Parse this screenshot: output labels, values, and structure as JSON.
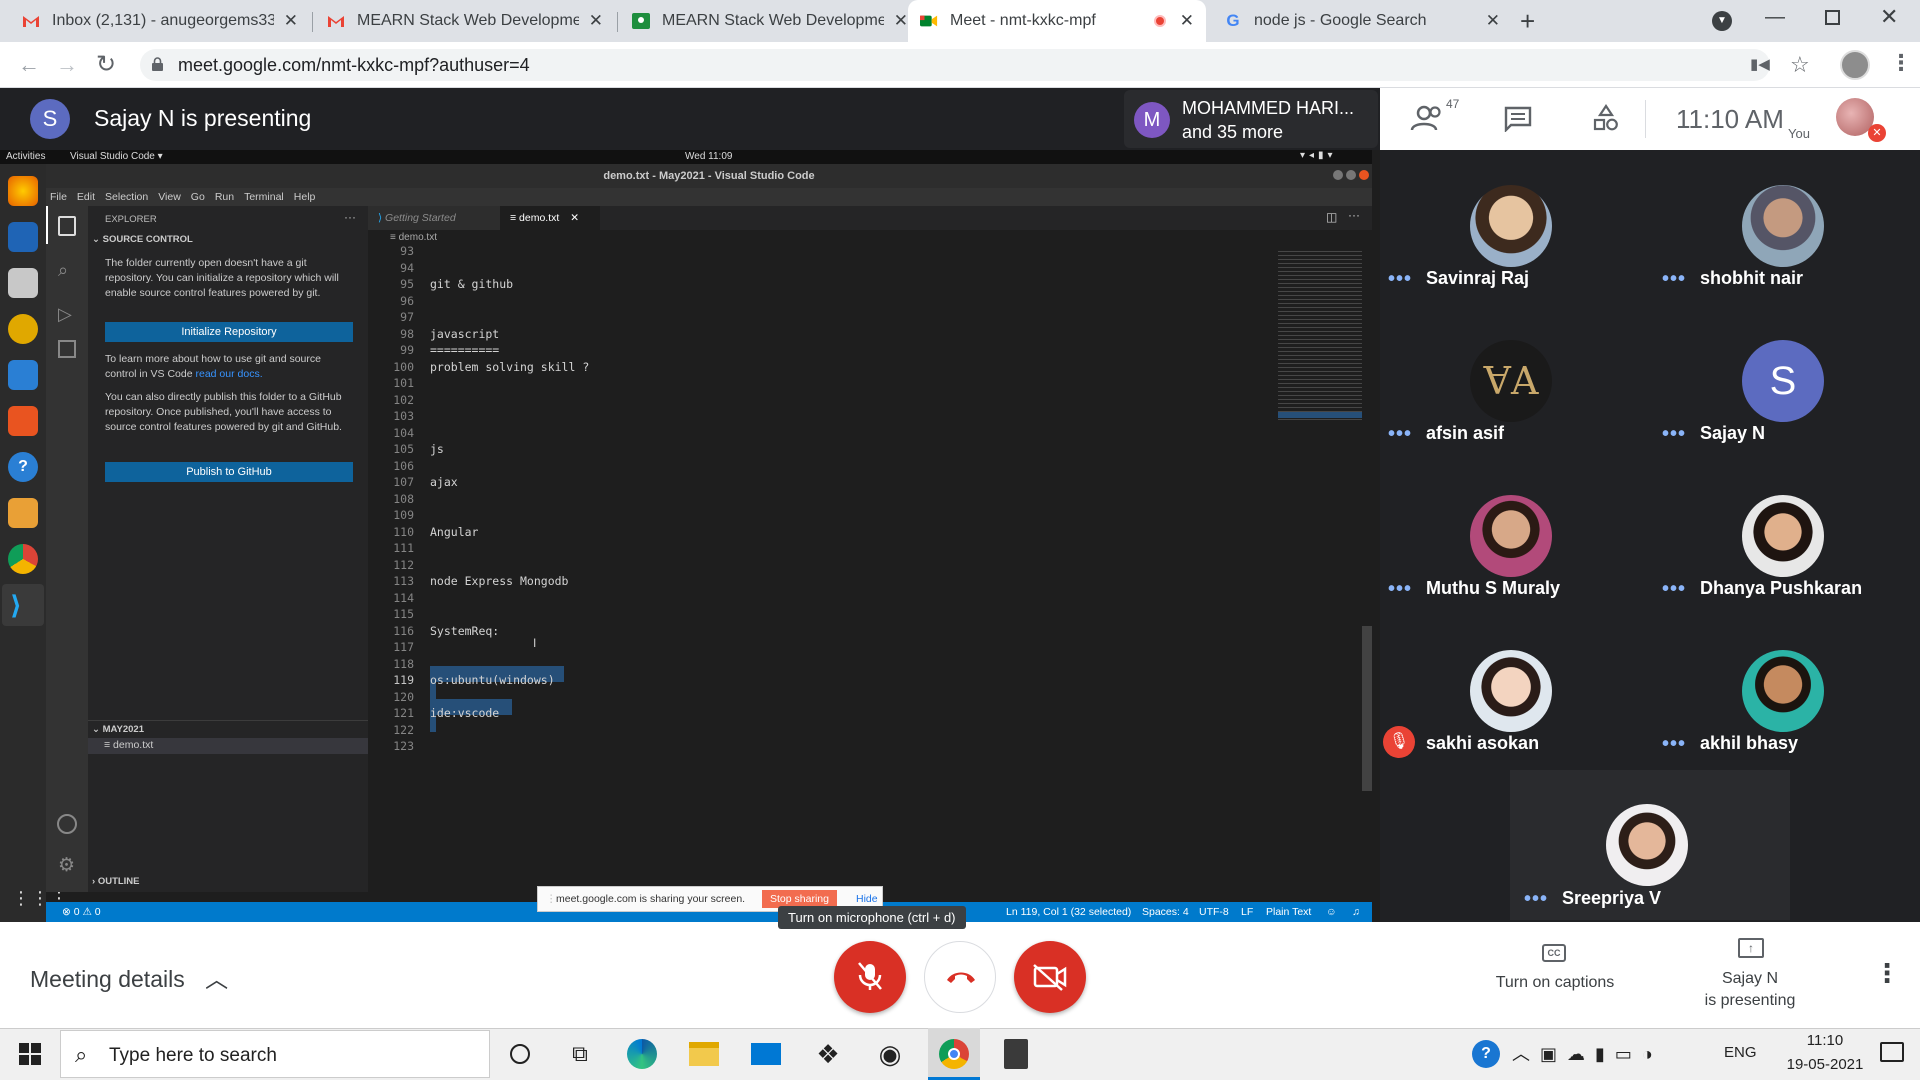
{
  "browser": {
    "tabs": [
      {
        "title": "Inbox (2,131) - anugeorgems333"
      },
      {
        "title": "MEARN Stack Web Development"
      },
      {
        "title": "MEARN Stack Web Development"
      },
      {
        "title": "Meet - nmt-kxkc-mpf"
      },
      {
        "title": "node js - Google Search"
      }
    ],
    "url": "meet.google.com/nmt-kxkc-mpf?authuser=4"
  },
  "meet": {
    "presenter_initial": "S",
    "presenting_title": "Sajay N is presenting",
    "pinned_initial": "M",
    "pinned_name": "MOHAMMED HARI...",
    "pinned_more": "and 35 more",
    "participant_count": "47",
    "time": "11:10 AM",
    "you_label": "You",
    "participants": [
      {
        "name": "Savinraj Raj"
      },
      {
        "name": "shobhit nair"
      },
      {
        "name": "afsin asif"
      },
      {
        "name": "Sajay N",
        "initial": "S"
      },
      {
        "name": "Muthu S Muraly"
      },
      {
        "name": "Dhanya Pushkaran"
      },
      {
        "name": "sakhi asokan"
      },
      {
        "name": "akhil bhasy"
      },
      {
        "name": "Sreepriya V"
      }
    ],
    "meeting_details": "Meeting details",
    "mic_tooltip": "Turn on microphone (ctrl + d)",
    "captions_label": "Turn on captions",
    "presenting_label_1": "Sajay N",
    "presenting_label_2": "is presenting",
    "share_notice": "meet.google.com is sharing your screen.",
    "stop_sharing": "Stop sharing",
    "hide": "Hide"
  },
  "ubuntu": {
    "activities": "Activities",
    "app_name": "Visual Studio Code ▾",
    "clock": "Wed 11:09"
  },
  "vscode": {
    "window_title": "demo.txt - May2021 - Visual Studio Code",
    "menu": [
      "File",
      "Edit",
      "Selection",
      "View",
      "Go",
      "Run",
      "Terminal",
      "Help"
    ],
    "explorer_title": "EXPLORER",
    "section": "SOURCE CONTROL",
    "msg1": "The folder currently open doesn't have a git repository. You can initialize a repository which will enable source control features powered by git.",
    "init_button": "Initialize Repository",
    "msg2": "To learn more about how to use git and source control in VS Code",
    "docs_link": "read our docs.",
    "msg3": "You can also directly publish this folder to a GitHub repository. Once published, you'll have access to source control features powered by git and GitHub.",
    "publish_button": "Publish to GitHub",
    "folder": "MAY2021",
    "file": "demo.txt",
    "outline": "OUTLINE",
    "tab_getting_started": "Getting Started",
    "tab_demo": "demo.txt",
    "breadcrumb": "demo.txt",
    "lines": [
      {
        "n": "93",
        "t": ""
      },
      {
        "n": "94",
        "t": ""
      },
      {
        "n": "95",
        "t": "git & github"
      },
      {
        "n": "96",
        "t": ""
      },
      {
        "n": "97",
        "t": ""
      },
      {
        "n": "98",
        "t": "javascript"
      },
      {
        "n": "99",
        "t": "=========="
      },
      {
        "n": "100",
        "t": "problem solving skill ?"
      },
      {
        "n": "101",
        "t": ""
      },
      {
        "n": "102",
        "t": ""
      },
      {
        "n": "103",
        "t": ""
      },
      {
        "n": "104",
        "t": ""
      },
      {
        "n": "105",
        "t": "js"
      },
      {
        "n": "106",
        "t": ""
      },
      {
        "n": "107",
        "t": "ajax"
      },
      {
        "n": "108",
        "t": ""
      },
      {
        "n": "109",
        "t": ""
      },
      {
        "n": "110",
        "t": "Angular"
      },
      {
        "n": "111",
        "t": ""
      },
      {
        "n": "112",
        "t": ""
      },
      {
        "n": "113",
        "t": "node Express Mongodb"
      },
      {
        "n": "114",
        "t": ""
      },
      {
        "n": "115",
        "t": ""
      },
      {
        "n": "116",
        "t": "SystemReq:"
      },
      {
        "n": "117",
        "t": ""
      },
      {
        "n": "118",
        "t": ""
      },
      {
        "n": "119",
        "t": "os:ubuntu(windows)"
      },
      {
        "n": "120",
        "t": ""
      },
      {
        "n": "121",
        "t": "ide:vscode"
      },
      {
        "n": "122",
        "t": ""
      },
      {
        "n": "123",
        "t": ""
      }
    ],
    "status_left": "⊗ 0 ⚠ 0",
    "status_pos": "Ln 119, Col 1 (32 selected)",
    "status_spaces": "Spaces: 4",
    "status_enc": "UTF-8",
    "status_eol": "LF",
    "status_lang": "Plain Text"
  },
  "taskbar": {
    "search_placeholder": "Type here to search",
    "lang": "ENG",
    "time": "11:10",
    "date": "19-05-2021"
  },
  "colors": {
    "meet_red": "#ea4335",
    "vscode_blue": "#007acc",
    "meet_bg": "#202124"
  }
}
